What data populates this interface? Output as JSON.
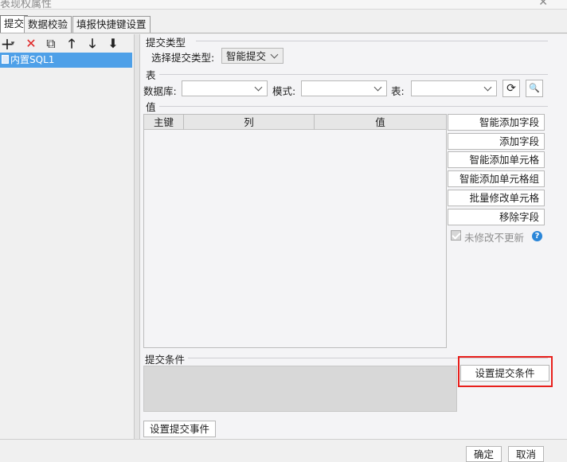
{
  "window": {
    "title": "表现权属性",
    "close_glyph": "✕"
  },
  "tabs": [
    {
      "label": "提交",
      "active": true
    },
    {
      "label": "数据校验",
      "active": false
    },
    {
      "label": "填报快捷键设置",
      "active": false
    }
  ],
  "toolbar": {
    "add_icon": "+",
    "add_dropdown": "▾",
    "delete_icon": "✕",
    "copy_icon": "⧉",
    "up_icon": "🡑",
    "down_icon": "🡓",
    "sort_icon": "⬇"
  },
  "tree": {
    "items": [
      {
        "label": "内置SQL1"
      }
    ]
  },
  "submit_type": {
    "section_title": "提交类型",
    "label": "选择提交类型:",
    "value": "智能提交"
  },
  "table_section": {
    "section_title": "表",
    "database_label": "数据库:",
    "database_value": "",
    "schema_label": "模式:",
    "schema_value": "",
    "table_label": "表:",
    "table_value": "",
    "refresh_icon": "⟳",
    "preview_icon": "🔍"
  },
  "value_section": {
    "section_title": "值",
    "columns": [
      "主键",
      "列",
      "值"
    ],
    "buttons": [
      "智能添加字段",
      "添加字段",
      "智能添加单元格",
      "智能添加单元格组",
      "批量修改单元格",
      "移除字段"
    ],
    "checkbox_label": "未修改不更新",
    "checkbox_checked": true,
    "help_icon": "?"
  },
  "condition_section": {
    "section_title": "提交条件",
    "set_condition_button": "设置提交条件"
  },
  "event_button": "设置提交事件",
  "footer": {
    "ok": "确定",
    "cancel": "取消"
  },
  "colors": {
    "selection": "#4ea0e8",
    "delete_red": "#e02424",
    "highlight_red": "#e8201c",
    "help_blue": "#2a86d8"
  }
}
